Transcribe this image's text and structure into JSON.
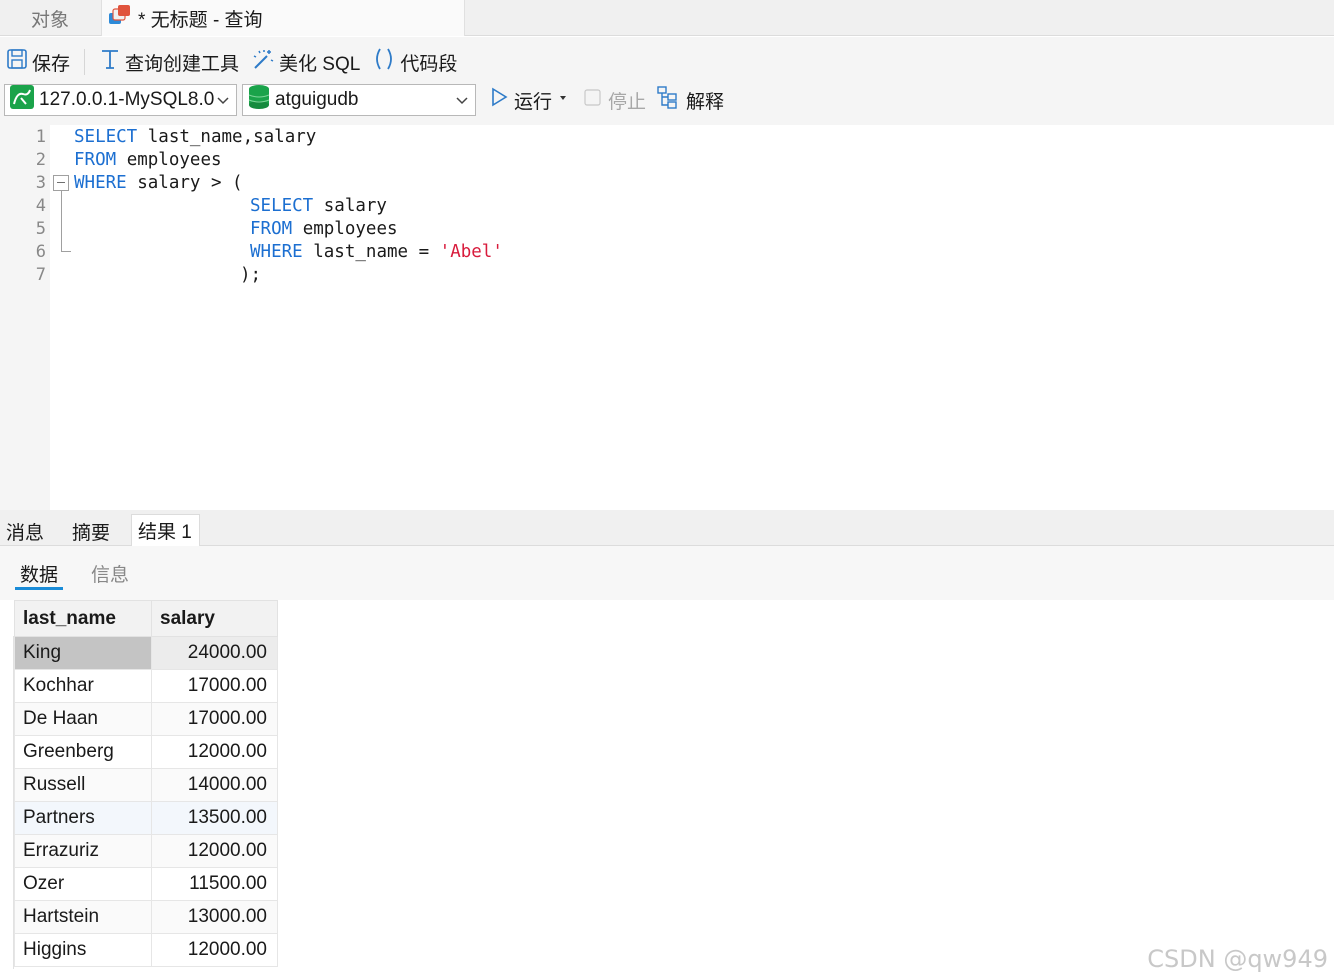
{
  "tabs": {
    "objects": "对象",
    "query": "* 无标题 - 查询"
  },
  "toolbar": {
    "save": "保存",
    "query_builder": "查询创建工具",
    "beautify": "美化 SQL",
    "snippet": "代码段",
    "connection": "127.0.0.1-MySQL8.0",
    "database": "atguigudb",
    "run": "运行",
    "stop": "停止",
    "explain": "解释"
  },
  "editor": {
    "line_numbers": [
      "1",
      "2",
      "3",
      "4",
      "5",
      "6",
      "7"
    ],
    "lines": [
      {
        "kw": "SELECT",
        "rest": " last_name,salary"
      },
      {
        "kw": "FROM",
        "rest": " employees"
      },
      {
        "kw": "WHERE",
        "rest": " salary > ("
      },
      {
        "kw": "SELECT",
        "rest": " salary"
      },
      {
        "kw": "FROM",
        "rest": " employees"
      },
      {
        "kw": "WHERE",
        "rest": " last_name = ",
        "str": "'Abel'"
      },
      {
        "rest": ");"
      }
    ]
  },
  "result_tabs": [
    "消息",
    "摘要",
    "结果 1"
  ],
  "sub_tabs": [
    "数据",
    "信息"
  ],
  "grid": {
    "columns": [
      "last_name",
      "salary"
    ],
    "rows": [
      [
        "King",
        "24000.00"
      ],
      [
        "Kochhar",
        "17000.00"
      ],
      [
        "De Haan",
        "17000.00"
      ],
      [
        "Greenberg",
        "12000.00"
      ],
      [
        "Russell",
        "14000.00"
      ],
      [
        "Partners",
        "13500.00"
      ],
      [
        "Errazuriz",
        "12000.00"
      ],
      [
        "Ozer",
        "11500.00"
      ],
      [
        "Hartstein",
        "13000.00"
      ],
      [
        "Higgins",
        "12000.00"
      ]
    ]
  },
  "watermark": "CSDN @qw949"
}
